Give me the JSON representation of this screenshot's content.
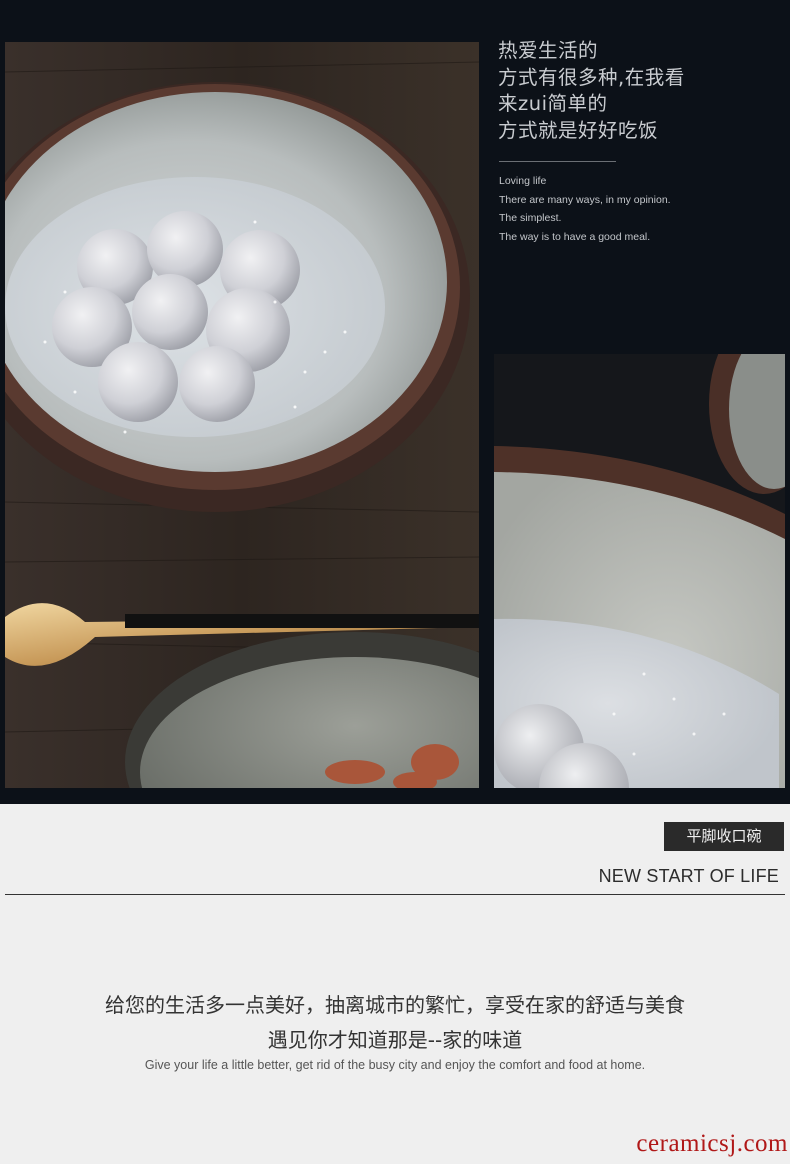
{
  "hero": {
    "heading_lines": [
      "热爱生活的",
      "方式有很多种,在我看",
      "来zui简单的",
      "方式就是好好吃饭"
    ],
    "english_lines": [
      "Loving life",
      "There are many ways, in my opinion.",
      "The simplest.",
      "The way is to have a good meal."
    ]
  },
  "section": {
    "label": "平脚收口碗",
    "title_en": "NEW START OF LIFE"
  },
  "body": {
    "cn_line1": "给您的生活多一点美好，抽离城市的繁忙，享受在家的舒适与美食",
    "cn_line2": "遇见你才知道那是--家的味道",
    "en_line": "Give your life a little better, get rid of the busy city and enjoy the comfort and food at home."
  },
  "watermark": "ceramicsj.com",
  "colors": {
    "hero_bg": "#0c1118",
    "page_bg": "#efefef",
    "label_bg": "#2a2a2a",
    "watermark": "#b01818"
  }
}
